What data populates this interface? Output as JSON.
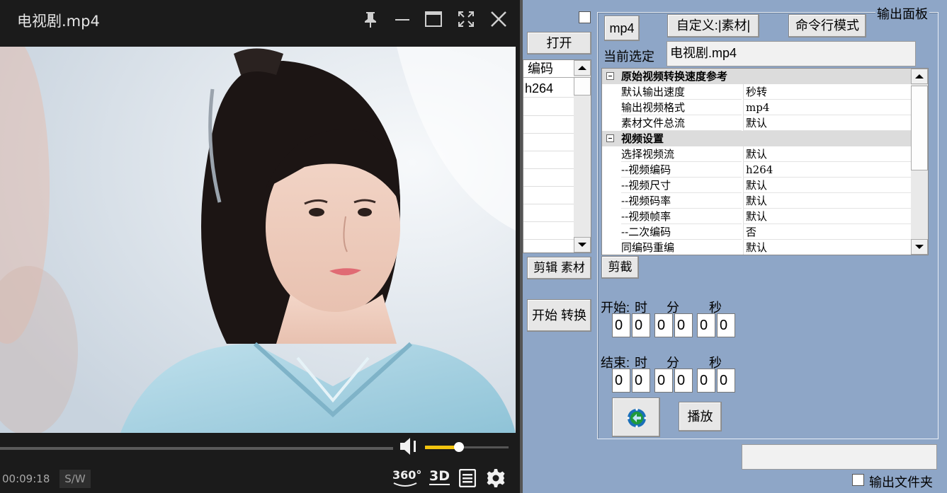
{
  "player": {
    "title": "电视剧.mp4",
    "time": "00:09:18",
    "sw_label": "S/W",
    "label_360": "360°",
    "label_3d": "3D",
    "volume_fraction": 0.41,
    "icons": [
      "pin-icon",
      "minimize-icon",
      "maximize-icon",
      "fullscreen-icon",
      "close-icon",
      "volume-icon",
      "360-icon",
      "3d-icon",
      "playlist-icon",
      "settings-icon"
    ]
  },
  "panel": {
    "top_checkbox_checked": false,
    "open_button": "打开",
    "list_header": "编码",
    "list_items": [
      "h264"
    ],
    "edit_material_button": "剪辑 素材",
    "start_convert_button": "开始 转换",
    "frame_title": "输出面板",
    "format_button": "mp4",
    "custom_button": "自定义:|素材|",
    "cmd_button": "命令行模式",
    "current_label": "当前选定",
    "current_value": "电视剧.mp4",
    "grid_rows": [
      {
        "type": "category",
        "name": "原始视频转换速度参考"
      },
      {
        "type": "row",
        "name": "默认输出速度",
        "value": "秒转"
      },
      {
        "type": "row",
        "name": "输出视频格式",
        "value": "mp4"
      },
      {
        "type": "row",
        "name": "素材文件总流",
        "value": "默认"
      },
      {
        "type": "category",
        "name": "视频设置"
      },
      {
        "type": "row",
        "name": "选择视频流",
        "value": "默认"
      },
      {
        "type": "row",
        "name": "--视频编码",
        "value": "h264"
      },
      {
        "type": "row",
        "name": "--视频尺寸",
        "value": "默认"
      },
      {
        "type": "row",
        "name": "--视频码率",
        "value": "默认"
      },
      {
        "type": "row",
        "name": "--视频帧率",
        "value": "默认"
      },
      {
        "type": "row",
        "name": "--二次编码",
        "value": "否"
      },
      {
        "type": "row",
        "name": "同编码重编",
        "value": "默认"
      }
    ],
    "cut_button": "剪截",
    "start_label": "开始:",
    "end_label": "结束:",
    "hour_label": "时",
    "minute_label": "分",
    "second_label": "秒",
    "start_digits": [
      "0",
      "0",
      "0",
      "0",
      "0",
      "0"
    ],
    "end_digits": [
      "0",
      "0",
      "0",
      "0",
      "0",
      "0"
    ],
    "play_button": "播放",
    "output_path_value": "",
    "output_folder_label": "输出文件夹",
    "output_folder_checked": false
  }
}
